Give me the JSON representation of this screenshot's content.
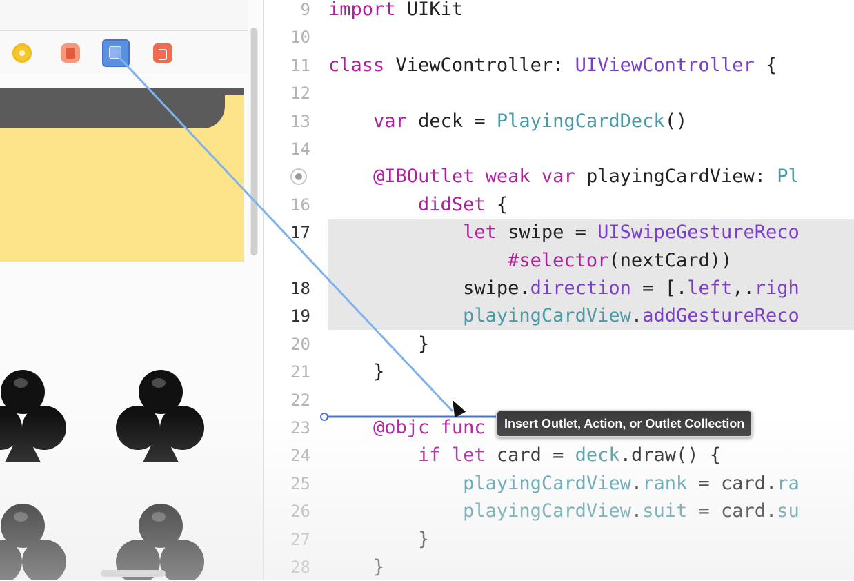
{
  "storyboard": {
    "dock_icons": [
      "view-controller-icon",
      "first-responder-icon",
      "swipe-gesture-recognizer-icon",
      "exit-icon"
    ],
    "card_color": "#fde488",
    "card_band_color": "#5b5b5b",
    "suit_glyph": "club-icon"
  },
  "editor": {
    "lines": [
      {
        "num": "9",
        "tokens": [
          {
            "t": "import",
            "c": "kw"
          },
          {
            "t": " UIKit",
            "c": "pl"
          }
        ]
      },
      {
        "num": "10",
        "tokens": []
      },
      {
        "num": "11",
        "tokens": [
          {
            "t": "class",
            "c": "kw"
          },
          {
            "t": " ViewController: ",
            "c": "pl"
          },
          {
            "t": "UIViewController",
            "c": "ty"
          },
          {
            "t": " {",
            "c": "pl"
          }
        ]
      },
      {
        "num": "12",
        "tokens": []
      },
      {
        "num": "13",
        "tokens": [
          {
            "t": "    ",
            "c": "pl"
          },
          {
            "t": "var",
            "c": "kw"
          },
          {
            "t": " deck = ",
            "c": "pl"
          },
          {
            "t": "PlayingCardDeck",
            "c": "tm"
          },
          {
            "t": "()",
            "c": "pl"
          }
        ]
      },
      {
        "num": "14",
        "tokens": []
      },
      {
        "num": "",
        "tokens": [
          {
            "t": "    ",
            "c": "pl"
          },
          {
            "t": "@IBOutlet",
            "c": "at"
          },
          {
            "t": " ",
            "c": "pl"
          },
          {
            "t": "weak",
            "c": "kw"
          },
          {
            "t": " ",
            "c": "pl"
          },
          {
            "t": "var",
            "c": "kw"
          },
          {
            "t": " playingCardView: ",
            "c": "pl"
          },
          {
            "t": "Pl",
            "c": "tm"
          }
        ]
      },
      {
        "num": "16",
        "tokens": [
          {
            "t": "        ",
            "c": "pl"
          },
          {
            "t": "didSet",
            "c": "kw"
          },
          {
            "t": " {",
            "c": "pl"
          }
        ]
      },
      {
        "num": "17",
        "tokens": [
          {
            "t": "            ",
            "c": "pl"
          },
          {
            "t": "let",
            "c": "kw"
          },
          {
            "t": " swipe = ",
            "c": "pl"
          },
          {
            "t": "UISwipeGestureReco",
            "c": "ty"
          }
        ]
      },
      {
        "num": "",
        "tokens": [
          {
            "t": "                ",
            "c": "pl"
          },
          {
            "t": "#selector",
            "c": "kw"
          },
          {
            "t": "(nextCard))",
            "c": "pl"
          }
        ]
      },
      {
        "num": "18",
        "tokens": [
          {
            "t": "            swipe.",
            "c": "pl"
          },
          {
            "t": "direction",
            "c": "ty"
          },
          {
            "t": " = [.",
            "c": "pl"
          },
          {
            "t": "left",
            "c": "ty"
          },
          {
            "t": ",.",
            "c": "pl"
          },
          {
            "t": "righ",
            "c": "ty"
          }
        ]
      },
      {
        "num": "19",
        "tokens": [
          {
            "t": "            ",
            "c": "pl"
          },
          {
            "t": "playingCardView",
            "c": "tm"
          },
          {
            "t": ".",
            "c": "pl"
          },
          {
            "t": "addGestureReco",
            "c": "ty"
          }
        ]
      },
      {
        "num": "20",
        "tokens": [
          {
            "t": "        }",
            "c": "pl"
          }
        ]
      },
      {
        "num": "21",
        "tokens": [
          {
            "t": "    }",
            "c": "pl"
          }
        ]
      },
      {
        "num": "22",
        "tokens": []
      },
      {
        "num": "23",
        "tokens": [
          {
            "t": "    ",
            "c": "pl"
          },
          {
            "t": "@objc",
            "c": "at"
          },
          {
            "t": " ",
            "c": "pl"
          },
          {
            "t": "func",
            "c": "kw"
          }
        ]
      },
      {
        "num": "24",
        "tokens": [
          {
            "t": "        ",
            "c": "pl"
          },
          {
            "t": "if",
            "c": "kw"
          },
          {
            "t": " ",
            "c": "pl"
          },
          {
            "t": "let",
            "c": "kw"
          },
          {
            "t": " card = ",
            "c": "pl"
          },
          {
            "t": "deck",
            "c": "tm"
          },
          {
            "t": ".draw() {",
            "c": "pl"
          }
        ]
      },
      {
        "num": "25",
        "tokens": [
          {
            "t": "            ",
            "c": "pl"
          },
          {
            "t": "playingCardView",
            "c": "tm"
          },
          {
            "t": ".",
            "c": "pl"
          },
          {
            "t": "rank",
            "c": "tm"
          },
          {
            "t": " = card.",
            "c": "pl"
          },
          {
            "t": "ra",
            "c": "tm"
          }
        ]
      },
      {
        "num": "26",
        "tokens": [
          {
            "t": "            ",
            "c": "pl"
          },
          {
            "t": "playingCardView",
            "c": "tm"
          },
          {
            "t": ".",
            "c": "pl"
          },
          {
            "t": "suit",
            "c": "tm"
          },
          {
            "t": " = card.",
            "c": "pl"
          },
          {
            "t": "su",
            "c": "tm"
          }
        ]
      },
      {
        "num": "27",
        "tokens": [
          {
            "t": "        }",
            "c": "pl"
          }
        ]
      },
      {
        "num": "28",
        "tokens": [
          {
            "t": "    }",
            "c": "pl"
          }
        ]
      }
    ],
    "current_line_numbers": [
      "17",
      "18",
      "19"
    ]
  },
  "connection": {
    "tooltip": "Insert Outlet, Action, or Outlet Collection"
  }
}
